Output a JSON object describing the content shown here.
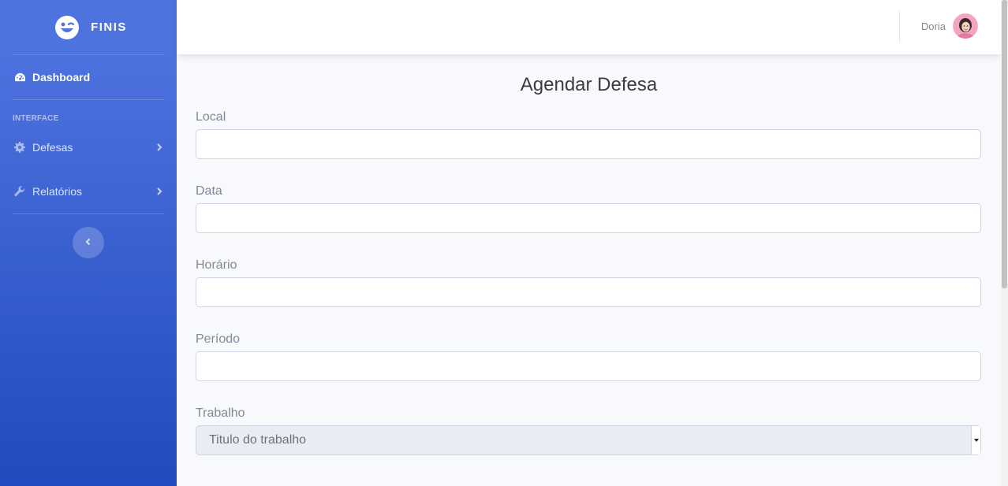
{
  "brand": {
    "name": "FINIS",
    "icon": "laugh-wink-icon"
  },
  "sidebar": {
    "dashboard_label": "Dashboard",
    "heading": "INTERFACE",
    "items": [
      {
        "label": "Defesas",
        "icon": "gear-icon"
      },
      {
        "label": "Relatórios",
        "icon": "wrench-icon"
      }
    ],
    "toggle_icon": "chevron-left-icon"
  },
  "topbar": {
    "user_name": "Doria"
  },
  "page": {
    "title": "Agendar Defesa"
  },
  "form": {
    "local_label": "Local",
    "local_value": "",
    "data_label": "Data",
    "data_value": "",
    "horario_label": "Horário",
    "horario_value": "",
    "periodo_label": "Período",
    "periodo_value": "",
    "trabalho_label": "Trabalho",
    "trabalho_selected": "Titulo do trabalho"
  },
  "colors": {
    "sidebar_top": "#4e73df",
    "sidebar_bottom": "#224abe",
    "page_bg": "#f8f9fc",
    "text_muted": "#858796"
  }
}
